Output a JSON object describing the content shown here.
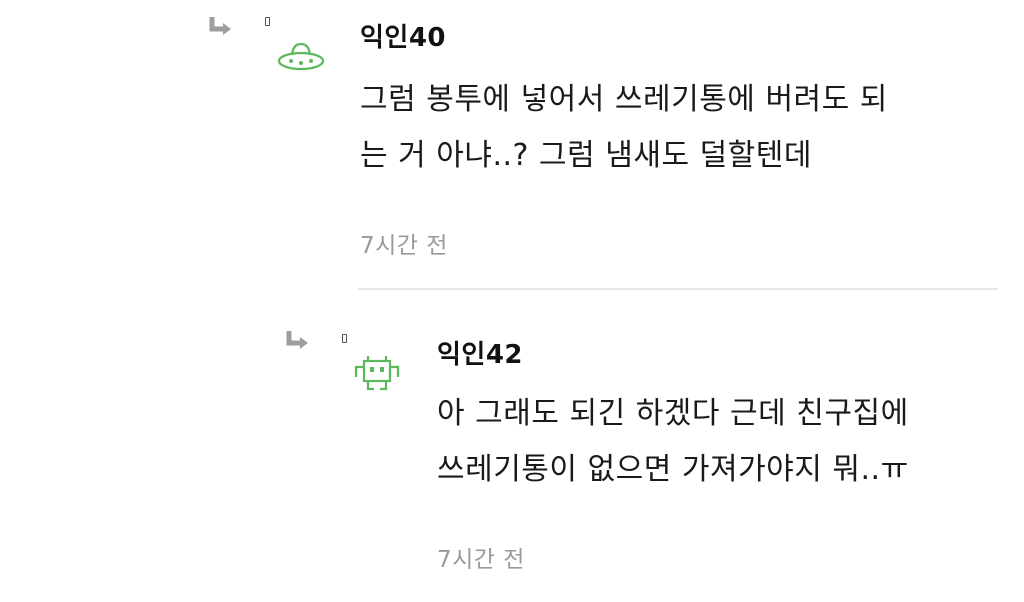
{
  "comments": [
    {
      "author": "익인40",
      "avatar": "ufo-icon",
      "body": "그럼 봉투에 넣어서 쓰레기통에 버려도 되\n는 거 아냐..? 그럼 냄새도 덜할텐데",
      "time": "7시간 전"
    },
    {
      "author": "익인42",
      "avatar": "space-invader-icon",
      "body": "아 그래도 되긴 하겠다 근데 친구집에\n쓰레기통이 없으면 가져가야지 뭐..ㅠ",
      "time": "7시간 전"
    }
  ],
  "colors": {
    "avatar_green": "#5cb85c",
    "time_gray": "#9a9a9a",
    "arrow_gray": "#9e9e9e"
  }
}
